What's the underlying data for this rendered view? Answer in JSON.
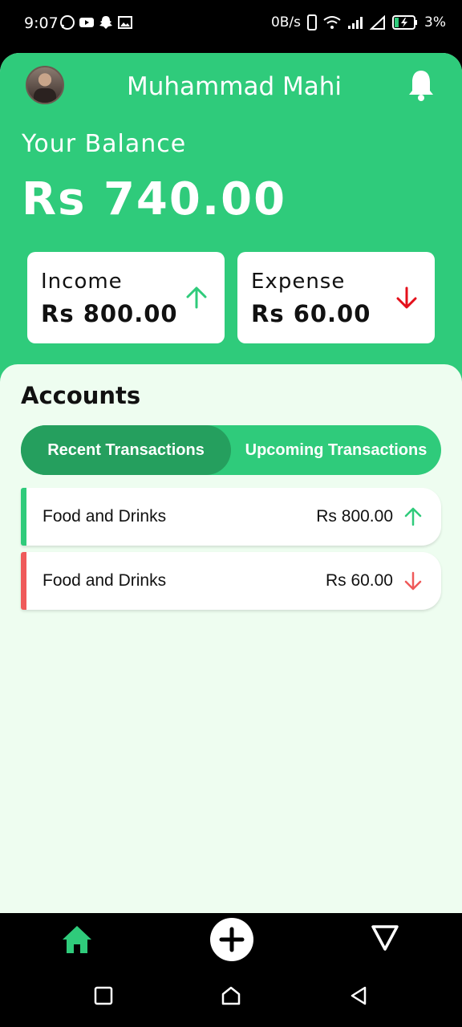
{
  "status_bar": {
    "time": "9:07",
    "network_speed": "0B/s",
    "battery": "3%",
    "icons": [
      "whatsapp-icon",
      "youtube-icon",
      "snapchat-icon",
      "gallery-icon",
      "vibrate-icon",
      "wifi-icon",
      "signal-icon",
      "battery-charging-icon"
    ]
  },
  "header": {
    "user_name": "Muhammad Mahi",
    "balance_label": "Your Balance",
    "balance_amount": "Rs 740.00"
  },
  "cards": {
    "income": {
      "label": "Income",
      "value": "Rs 800.00"
    },
    "expense": {
      "label": "Expense",
      "value": "Rs 60.00"
    }
  },
  "accounts": {
    "title": "Accounts",
    "tabs": [
      {
        "label": "Recent Transactions",
        "active": true
      },
      {
        "label": "Upcoming Transactions",
        "active": false
      }
    ],
    "transactions": [
      {
        "name": "Food and Drinks",
        "amount": "Rs 800.00",
        "type": "income"
      },
      {
        "name": "Food and Drinks",
        "amount": "Rs 60.00",
        "type": "expense"
      }
    ]
  },
  "colors": {
    "primary": "#2fcb7b",
    "primary_dark": "#259f5e",
    "background": "#eefdf0",
    "income": "#2fcb7b",
    "expense": "#ef5a5a",
    "expense_strong": "#e4101b"
  },
  "bottom_nav": {
    "items": [
      "home-icon",
      "add-icon",
      "triangle-icon"
    ]
  }
}
